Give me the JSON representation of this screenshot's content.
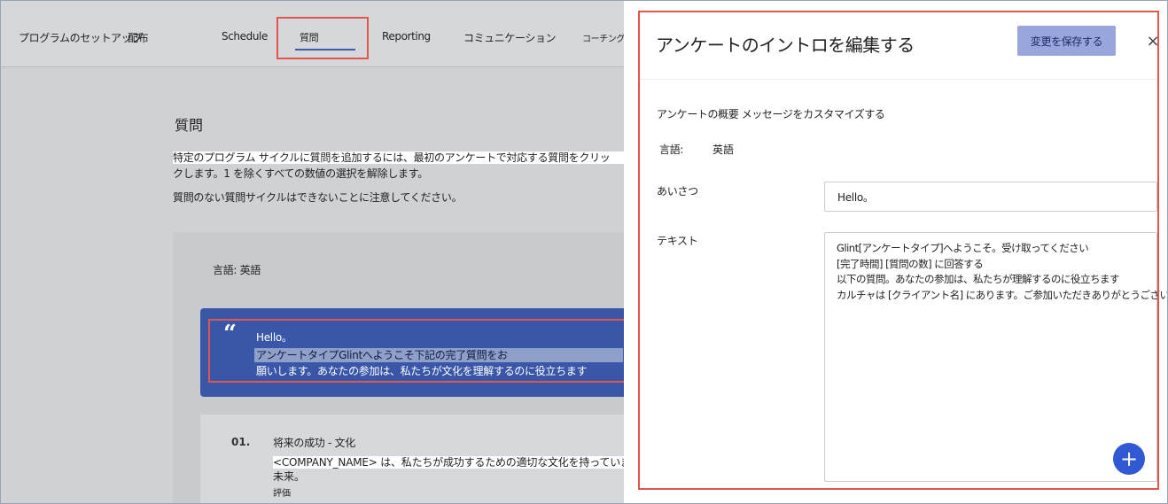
{
  "nav": {
    "items": [
      "プログラムのセットアップ",
      "配布",
      "Schedule",
      "質問",
      "Reporting",
      "コミュニケーション",
      "コーチング"
    ],
    "active": "質問"
  },
  "page": {
    "title": "質問",
    "instruction_line1": "特定のプログラム サイクルに質問を追加するには、最初のアンケートで対応する質問をクリッ",
    "instruction_line2": "クします。1 を除くすべての数値の選択を解除します。",
    "note": "質問のない質問サイクルはできないことに注意してください。",
    "language_label": "言語: 英語",
    "intro_card": {
      "greeting": "Hello。",
      "line1": "アンケートタイプGlintへようこそ下記の完了質問をお",
      "line2": "願いします。あなたの参加は、私たちが文化を理解するのに役立ちます"
    },
    "question": {
      "number": "01.",
      "title": "将来の成功 - 文化",
      "body": "<COMPANY_NAME> は、私たちが成功するための適切な文化を持っています</COMPANY_NAME>",
      "body_cont": "未来。",
      "type": "評価"
    }
  },
  "panel": {
    "title": "アンケートのイントロを編集する",
    "save_label": "変更を保存する",
    "close_label": "×",
    "subtitle": "アンケートの概要 メッセージをカスタマイズする",
    "language_key": "言語:",
    "language_value": "英語",
    "greeting_label": "あいさつ",
    "greeting_value": "Hello。",
    "text_label": "テキスト",
    "text_lines": [
      "Glint[アンケートタイプ]へようこそ。受け取ってください",
      "[完了時間] [質問の数] に回答する",
      "以下の質問。あなたの参加は、私たちが理解するのに役立ちます",
      "カルチャは [クライアント名] にあります。ご参加いただきありがとうございました。"
    ],
    "add_label": "+"
  },
  "colors": {
    "accent": "#3956a8",
    "highlight": "#e2574c",
    "save_button": "#98a6dd",
    "add_button": "#3159d3"
  }
}
